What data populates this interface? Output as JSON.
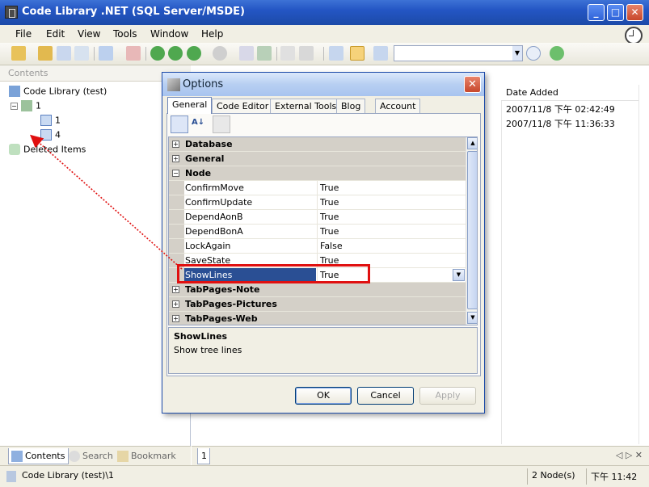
{
  "window": {
    "title": "Code Library .NET (SQL Server/MSDE)",
    "controls": {
      "minimize": "_",
      "maximize": "□",
      "close": "✕"
    }
  },
  "menu": [
    "File",
    "Edit",
    "View",
    "Tools",
    "Window",
    "Help"
  ],
  "toolbar": {
    "search_value": "",
    "search_arrow": "▼"
  },
  "left_pane": {
    "header": "Contents",
    "tree": {
      "root": "Code Library (test)",
      "node": "1",
      "children": [
        "1",
        "4"
      ],
      "deleted": "Deleted Items",
      "expander": "−"
    },
    "tabs": [
      "Contents",
      "Search",
      "Bookmark"
    ]
  },
  "right_pane": {
    "column": "Date Added",
    "rows": [
      "2007/11/8 下午 02:42:49",
      "2007/11/8 下午 11:36:33"
    ],
    "footer_tab": "1",
    "nav_arrows": "◁ ▷ ✕"
  },
  "dialog": {
    "title": "Options",
    "close": "✕",
    "tabs": [
      "General",
      "Code Editor",
      "External Tools",
      "Blog",
      "Account"
    ],
    "categories": {
      "database": "Database",
      "general": "General",
      "node": "Node",
      "tabpages_note": "TabPages-Note",
      "tabpages_pictures": "TabPages-Pictures",
      "tabpages_web": "TabPages-Web",
      "collapsed": "+",
      "expanded": "−"
    },
    "properties": [
      {
        "name": "ConfirmMove",
        "value": "True"
      },
      {
        "name": "ConfirmUpdate",
        "value": "True"
      },
      {
        "name": "DependAonB",
        "value": "True"
      },
      {
        "name": "DependBonA",
        "value": "True"
      },
      {
        "name": "LockAgain",
        "value": "False"
      },
      {
        "name": "SaveState",
        "value": "True"
      },
      {
        "name": "ShowLines",
        "value": "True"
      }
    ],
    "dropdown_arrow": "▼",
    "scroll_up": "▲",
    "scroll_down": "▼",
    "description": {
      "title": "ShowLines",
      "text": "Show tree lines"
    },
    "buttons": {
      "ok": "OK",
      "cancel": "Cancel",
      "apply": "Apply"
    }
  },
  "statusbar": {
    "path": "Code Library (test)\\1",
    "nodes": "2 Node(s)",
    "time": "下午 11:42"
  },
  "colors": {
    "title_blue": "#2456c4",
    "selection": "#2a4f94",
    "highlight_red": "#e01010"
  }
}
